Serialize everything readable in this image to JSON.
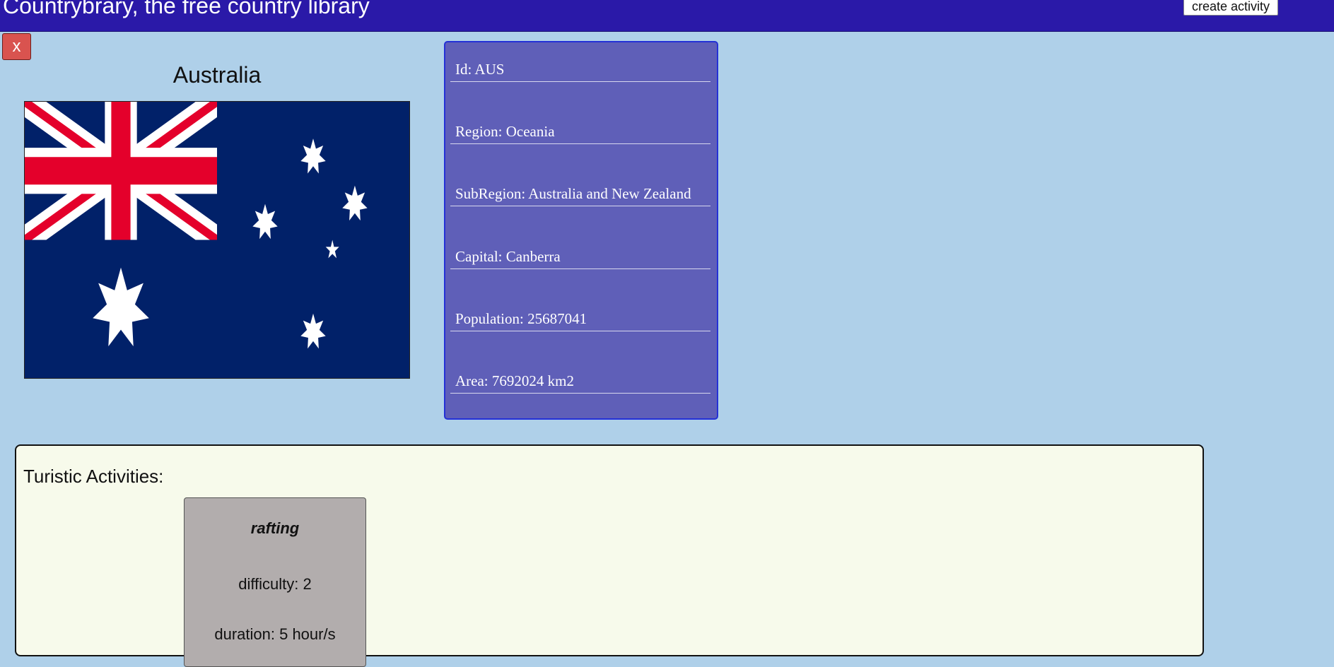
{
  "header": {
    "title": "Countrybrary, the free country library",
    "create_activity_label": "create activity"
  },
  "close_button": {
    "label": "x"
  },
  "country": {
    "name": "Australia",
    "flag_icon": "australia-flag",
    "details": [
      {
        "label": "Id: AUS"
      },
      {
        "label": "Region: Oceania"
      },
      {
        "label": "SubRegion: Australia and New Zealand"
      },
      {
        "label": "Capital: Canberra"
      },
      {
        "label": "Population: 25687041"
      },
      {
        "label": "Area: 7692024 km2"
      }
    ]
  },
  "activities": {
    "title": "Turistic Activities:",
    "items": [
      {
        "name": "rafting",
        "difficulty": "difficulty: 2",
        "duration": "duration: 5 hour/s"
      }
    ]
  },
  "colors": {
    "page_background": "#afd0e9",
    "header_background": "#2a19a8",
    "info_panel_background": "#5f5fb8",
    "close_button": "#d9534f",
    "activities_background": "#f7faeb",
    "activity_card": "#b2adad",
    "flag_blue": "#012169",
    "flag_red": "#e4002b"
  }
}
